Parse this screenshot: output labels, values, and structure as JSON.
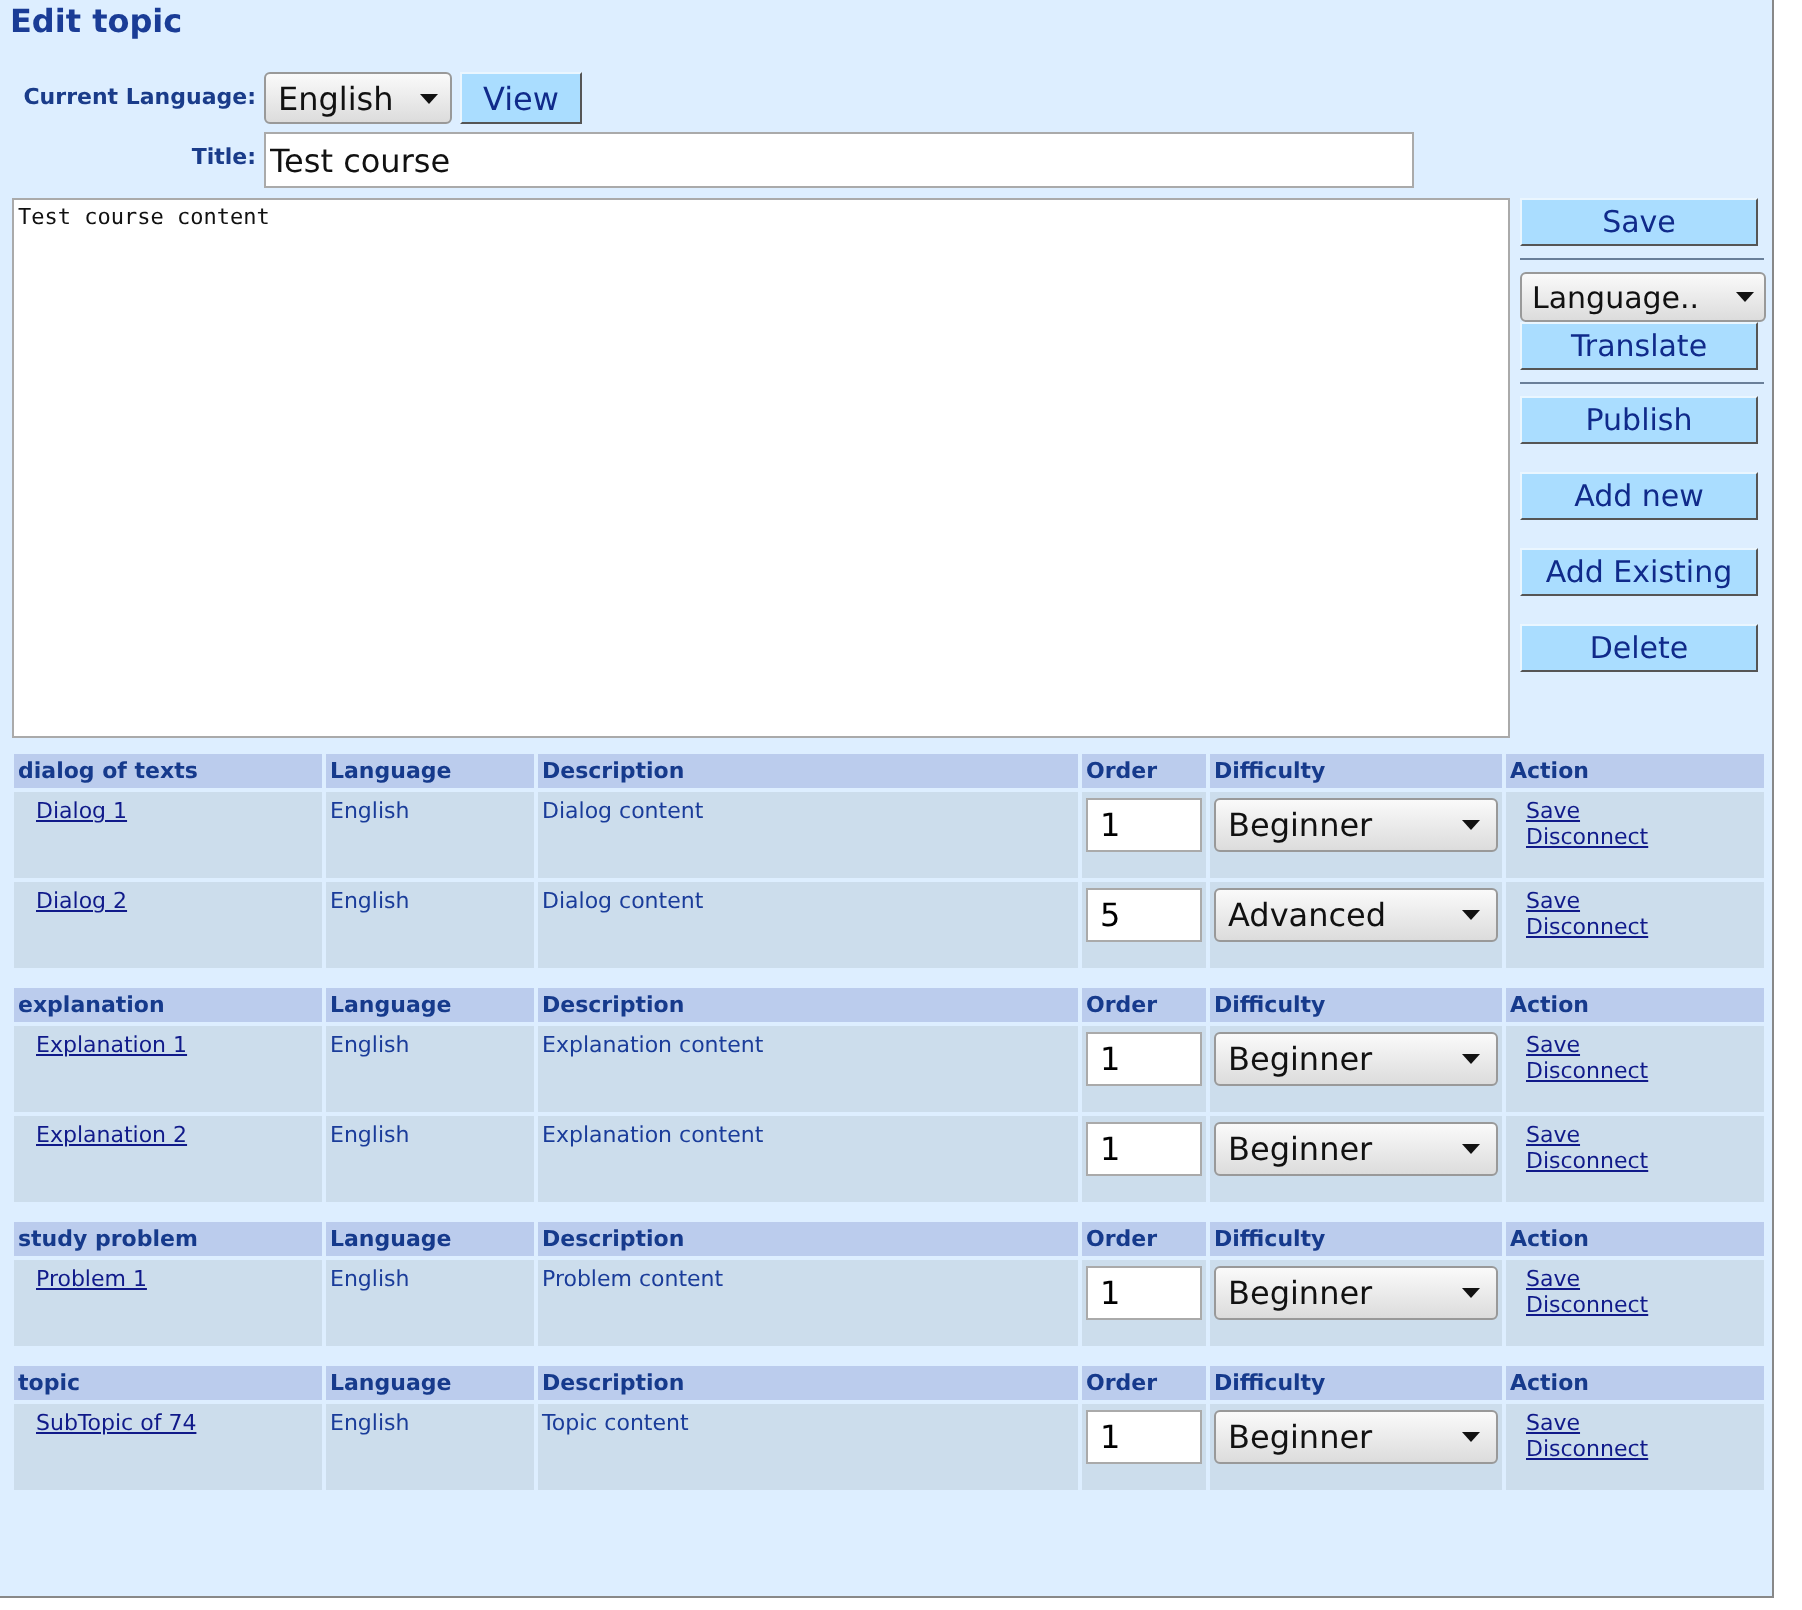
{
  "page": {
    "title": "Edit topic"
  },
  "form": {
    "language_label": "Current Language:",
    "language": "English",
    "view_button": "View",
    "title_label": "Title:",
    "title_value": "Test course",
    "content": "Test course content"
  },
  "side": {
    "save": "Save",
    "language_select": "Language..",
    "translate": "Translate",
    "actions": [
      "Publish",
      "Add new",
      "Add Existing",
      "Delete"
    ]
  },
  "sections": [
    {
      "columns": [
        "dialog of texts",
        "Language",
        "Description",
        "Order",
        "Difficulty",
        "Action"
      ],
      "rows": [
        {
          "name": "Dialog 1",
          "language": "English",
          "description": "Dialog content",
          "order": "1",
          "difficulty": "Beginner",
          "actions": [
            "Save",
            "Disconnect"
          ]
        },
        {
          "name": "Dialog 2",
          "language": "English",
          "description": "Dialog content",
          "order": "5",
          "difficulty": "Advanced",
          "actions": [
            "Save",
            "Disconnect"
          ]
        }
      ]
    },
    {
      "columns": [
        "explanation",
        "Language",
        "Description",
        "Order",
        "Difficulty",
        "Action"
      ],
      "rows": [
        {
          "name": "Explanation 1",
          "language": "English",
          "description": "Explanation content",
          "order": "1",
          "difficulty": "Beginner",
          "actions": [
            "Save",
            "Disconnect"
          ]
        },
        {
          "name": "Explanation 2",
          "language": "English",
          "description": "Explanation content",
          "order": "1",
          "difficulty": "Beginner",
          "actions": [
            "Save",
            "Disconnect"
          ]
        }
      ]
    },
    {
      "columns": [
        "study problem",
        "Language",
        "Description",
        "Order",
        "Difficulty",
        "Action"
      ],
      "rows": [
        {
          "name": "Problem 1",
          "language": "English",
          "description": "Problem content",
          "order": "1",
          "difficulty": "Beginner",
          "actions": [
            "Save",
            "Disconnect"
          ]
        }
      ]
    },
    {
      "columns": [
        "topic",
        "Language",
        "Description",
        "Order",
        "Difficulty",
        "Action"
      ],
      "rows": [
        {
          "name": "SubTopic of 74",
          "language": "English",
          "description": "Topic content",
          "order": "1",
          "difficulty": "Beginner",
          "actions": [
            "Save",
            "Disconnect"
          ]
        }
      ]
    }
  ]
}
